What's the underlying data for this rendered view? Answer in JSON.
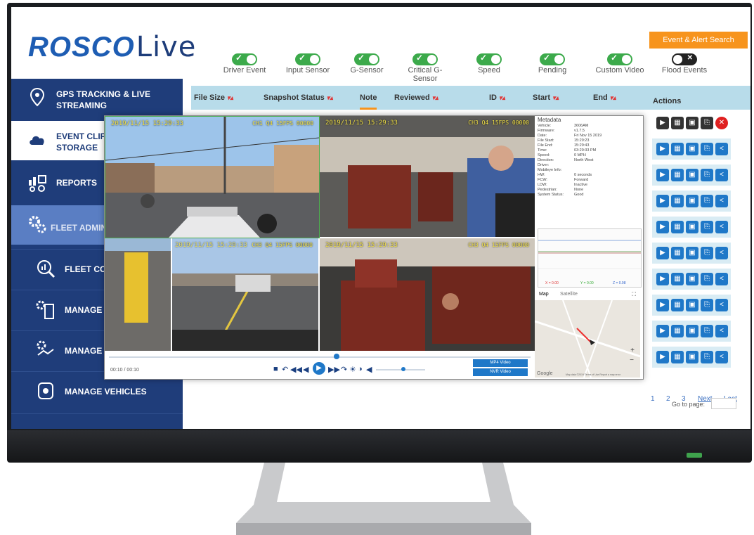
{
  "brand": {
    "name_part1": "ROSCO",
    "name_part2": "Live"
  },
  "header": {
    "event_search_label": "Event & Alert Search"
  },
  "filters": [
    {
      "label": "Driver Event",
      "on": true
    },
    {
      "label": "Input Sensor",
      "on": true
    },
    {
      "label": "G-Sensor",
      "on": true
    },
    {
      "label": "Critical G-Sensor",
      "on": true
    },
    {
      "label": "Speed",
      "on": true
    },
    {
      "label": "Pending",
      "on": true
    },
    {
      "label": "Custom Video",
      "on": true
    },
    {
      "label": "Flood Events",
      "on": false
    }
  ],
  "table": {
    "columns": [
      "File Size",
      "Snapshot Status",
      "Note",
      "Reviewed",
      "ID",
      "Start",
      "End"
    ],
    "actions_label": "Actions",
    "row_count": 10
  },
  "sidebar": {
    "items": [
      {
        "label": "GPS TRACKING & LIVE STREAMING"
      },
      {
        "label": "EVENT CLIPS STORAGE"
      },
      {
        "label": "REPORTS"
      },
      {
        "label": "FLEET ADMIN"
      },
      {
        "label": "FLEET CON"
      },
      {
        "label": "MANAGE C"
      },
      {
        "label": "MANAGE PA"
      },
      {
        "label": "MANAGE VEHICLES"
      }
    ]
  },
  "player": {
    "cam1_timestamp": "2019/11/15 15:29:33",
    "cam1_channel": "CH1 Q4 15FPS 00000",
    "cam2_timestamp": "2019/11/15 15:29:33",
    "cam2_channel": "CH3 Q4 15FPS 00000",
    "cam3_timestamp": "2019/11/15 15:29:33",
    "cam3_channel": "CH3 Q4 15FPS 00000",
    "time": "00:10 / 00:10",
    "formats": [
      "MP4 Video",
      "NVR Video"
    ],
    "metadata_title": "Metadata",
    "metadata": [
      [
        "Vehicle:",
        "3606AM"
      ],
      [
        "Firmware:",
        "v1.7.5"
      ],
      [
        "Date:",
        "Fri Nov 15 2019"
      ],
      [
        "File Start:",
        "15:29:23"
      ],
      [
        "File End:",
        "15:29:43"
      ],
      [
        "Time:",
        "03:29:33 PM"
      ],
      [
        "Speed:",
        "0 MPH"
      ],
      [
        "Direction:",
        "North West"
      ],
      [
        "Driver:",
        ""
      ],
      [
        "Mobileye Info:",
        ""
      ],
      [
        "HW:",
        "0 seconds"
      ],
      [
        "FCW:",
        "Forward"
      ],
      [
        "LDW:",
        "Inactive"
      ],
      [
        "Pedestrian:",
        "None"
      ],
      [
        "System Status:",
        "Good"
      ]
    ],
    "graph_x": "X = 0.00",
    "graph_y": "Y = 0.00",
    "graph_z": "Z = 0.98",
    "map_tab1": "Map",
    "map_tab2": "Satellite",
    "map_footer": "Map data ©2019  Terms of Use  Report a map error",
    "google": "Google"
  },
  "pager": {
    "pages": [
      "1",
      "2",
      "3"
    ],
    "next": "Next",
    "last": "Last",
    "goto_label": "Go to page:"
  }
}
